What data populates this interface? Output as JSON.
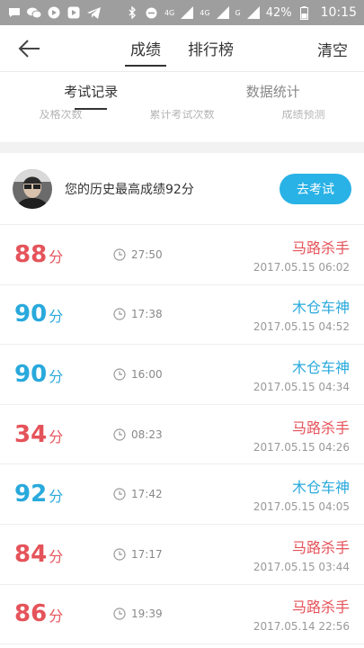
{
  "status_bar": {
    "network1": "4G",
    "network2": "4G",
    "network3": "G",
    "battery": "42%",
    "time": "10:15"
  },
  "app_bar": {
    "tabs": [
      "成绩",
      "排行榜"
    ],
    "active_tab": "成绩",
    "clear_label": "清空"
  },
  "sub_tabs": {
    "items": [
      "考试记录",
      "数据统计"
    ],
    "active": "考试记录"
  },
  "stats": {
    "labels": [
      "及格次数",
      "累计考试次数",
      "成绩预测"
    ]
  },
  "best": {
    "text": "您的历史最高成绩92分",
    "button_label": "去考试"
  },
  "records": [
    {
      "score": "88",
      "unit": "分",
      "duration": "27:50",
      "title": "马路杀手",
      "date": "2017.05.15  06:02",
      "color": "#e5535a"
    },
    {
      "score": "90",
      "unit": "分",
      "duration": "17:38",
      "title": "木仓车神",
      "date": "2017.05.15  04:52",
      "color": "#29a9dc"
    },
    {
      "score": "90",
      "unit": "分",
      "duration": "16:00",
      "title": "木仓车神",
      "date": "2017.05.15  04:34",
      "color": "#29a9dc"
    },
    {
      "score": "34",
      "unit": "分",
      "duration": "08:23",
      "title": "马路杀手",
      "date": "2017.05.15  04:26",
      "color": "#e5535a"
    },
    {
      "score": "92",
      "unit": "分",
      "duration": "17:42",
      "title": "木仓车神",
      "date": "2017.05.15  04:05",
      "color": "#29a9dc"
    },
    {
      "score": "84",
      "unit": "分",
      "duration": "17:17",
      "title": "马路杀手",
      "date": "2017.05.15  03:44",
      "color": "#e5535a"
    },
    {
      "score": "86",
      "unit": "分",
      "duration": "19:39",
      "title": "马路杀手",
      "date": "2017.05.14  22:56",
      "color": "#e5535a"
    }
  ]
}
